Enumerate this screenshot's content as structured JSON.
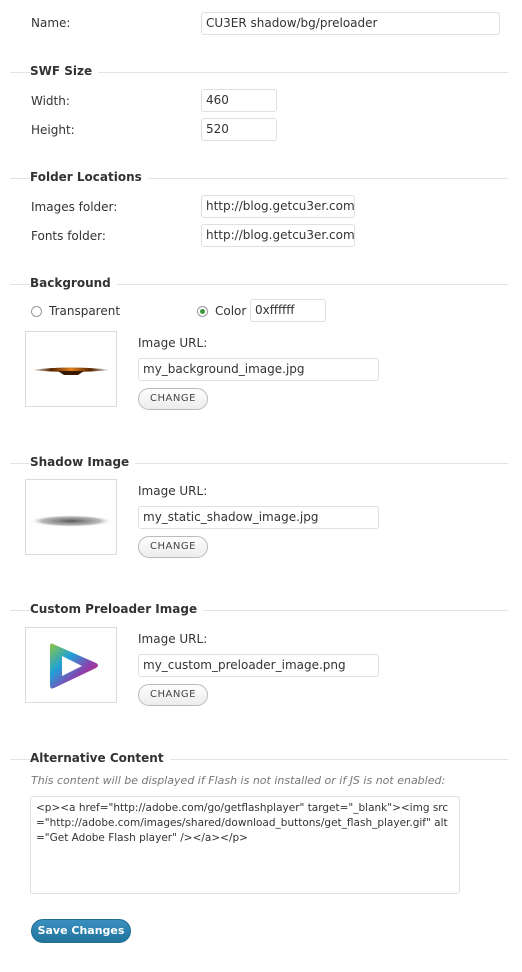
{
  "name": {
    "label": "Name:",
    "value": "CU3ER shadow/bg/preloader"
  },
  "swf_size": {
    "title": "SWF Size",
    "width_label": "Width:",
    "width_value": "460",
    "height_label": "Height:",
    "height_value": "520"
  },
  "folders": {
    "title": "Folder Locations",
    "images_label": "Images folder:",
    "images_value": "http://blog.getcu3er.com",
    "fonts_label": "Fonts folder:",
    "fonts_value": "http://blog.getcu3er.com"
  },
  "background": {
    "title": "Background",
    "transparent_label": "Transparent",
    "color_label": "Color",
    "color_value": "0xffffff",
    "image_url_label": "Image URL:",
    "image_url_value": "my_background_image.jpg",
    "change_label": "CHANGE"
  },
  "shadow": {
    "title": "Shadow Image",
    "image_url_label": "Image URL:",
    "image_url_value": "my_static_shadow_image.jpg",
    "change_label": "CHANGE"
  },
  "preloader": {
    "title": "Custom Preloader Image",
    "image_url_label": "Image URL:",
    "image_url_value": "my_custom_preloader_image.png",
    "change_label": "CHANGE"
  },
  "alt_content": {
    "title": "Alternative Content",
    "hint": "This content will be displayed if Flash is not installed or if JS is not enabled:",
    "value": "<p><a href=\"http://adobe.com/go/getflashplayer\" target=\"_blank\"><img src=\"http://adobe.com/images/shared/download_buttons/get_flash_player.gif\" alt=\"Get Adobe Flash player\" /></a></p>"
  },
  "save_label": "Save Changes",
  "colors": {
    "accent": "#21759b",
    "radio_checked": "#3a9a3a"
  }
}
